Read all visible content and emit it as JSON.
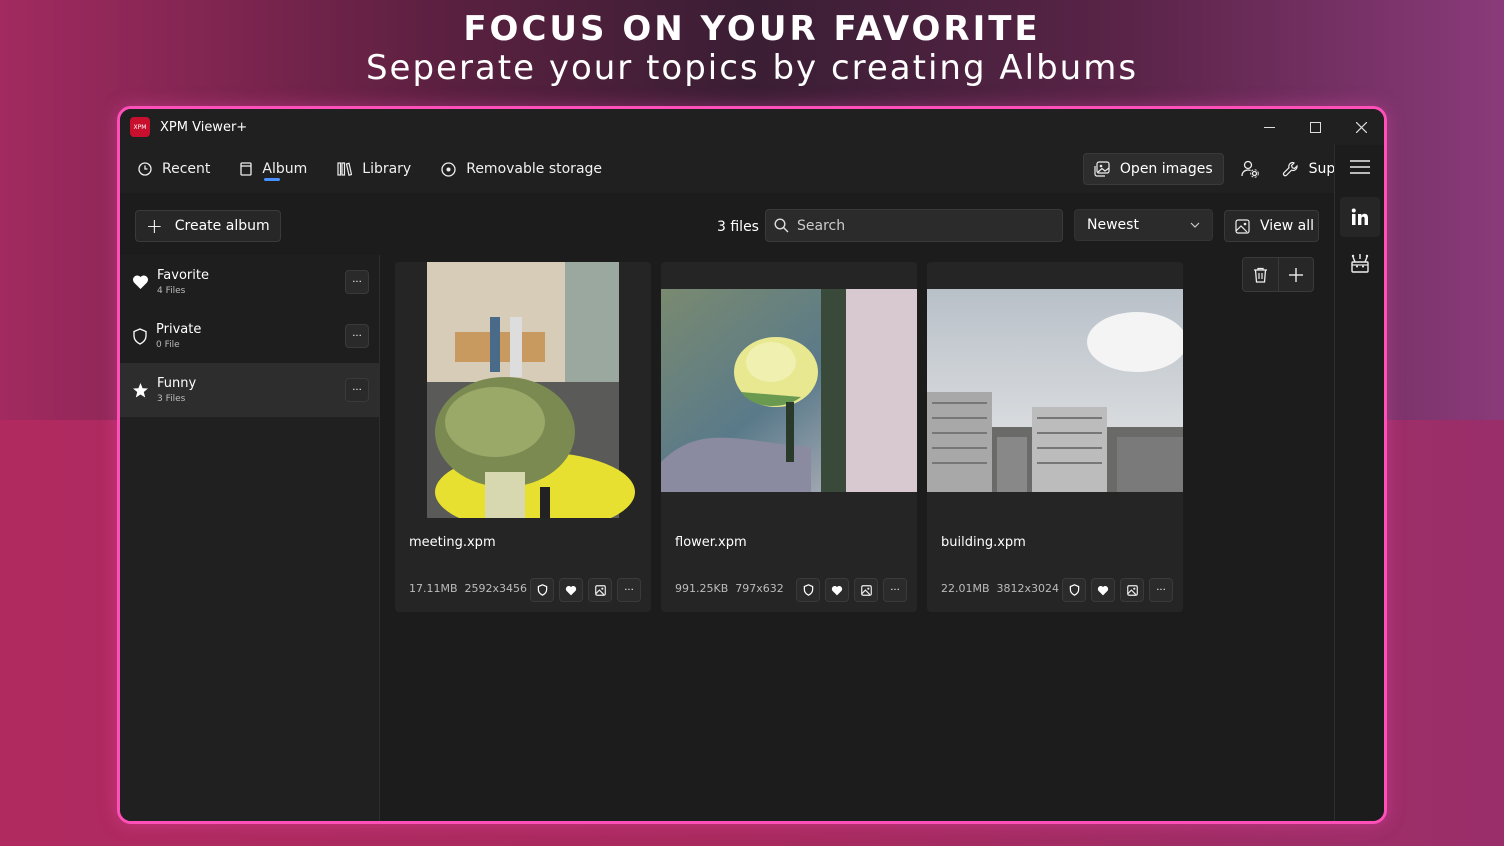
{
  "headline": {
    "title": "FOCUS ON YOUR FAVORITE",
    "subtitle": "Seperate your topics by creating Albums"
  },
  "window": {
    "title": "XPM Viewer+",
    "logo_text": "XPM"
  },
  "nav": {
    "recent": "Recent",
    "album": "Album",
    "library": "Library",
    "removable": "Removable storage",
    "open_images": "Open images",
    "support": "Support"
  },
  "toolbar": {
    "create_album": "Create album",
    "files_count": "3 files",
    "search_placeholder": "Search",
    "sort_value": "Newest",
    "view_all": "View all"
  },
  "albums": [
    {
      "name": "Favorite",
      "count": "4 Files",
      "icon": "heart-icon"
    },
    {
      "name": "Private",
      "count": "0 File",
      "icon": "shield-icon"
    },
    {
      "name": "Funny",
      "count": "3 Files",
      "icon": "star-icon",
      "active": true
    }
  ],
  "files": [
    {
      "name": "meeting.xpm",
      "size": "17.11MB",
      "dims": "2592x3456"
    },
    {
      "name": "flower.xpm",
      "size": "991.25KB",
      "dims": "797x632"
    },
    {
      "name": "building.xpm",
      "size": "22.01MB",
      "dims": "3812x3024"
    }
  ],
  "colors": {
    "accent_border": "#ff4fb8",
    "nav_underline": "#4a90ff",
    "window_bg": "#202020",
    "logo_red": "#c8102e"
  }
}
